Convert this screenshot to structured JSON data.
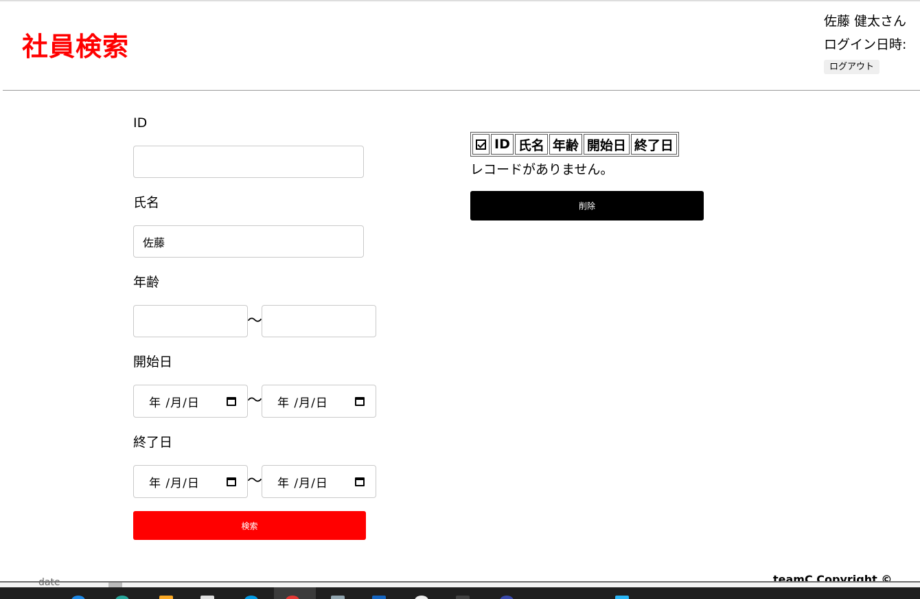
{
  "header": {
    "title": "社員検索",
    "user_name": "佐藤 健太さん",
    "login_label": "ログイン日時:",
    "logout_label": "ログアウト"
  },
  "form": {
    "id_label": "ID",
    "id_value": "",
    "name_label": "氏名",
    "name_value": "佐藤",
    "age_label": "年齢",
    "age_from": "",
    "age_to": "",
    "range_separator": "〜",
    "start_date_label": "開始日",
    "end_date_label": "終了日",
    "date_placeholder": "年 /月/日",
    "search_button": "検索"
  },
  "results": {
    "columns": [
      "☑",
      "ID",
      "氏名",
      "年齢",
      "開始日",
      "終了日"
    ],
    "empty_message": "レコードがありません。",
    "delete_button": "削除"
  },
  "footer": {
    "copyright": "teamC Copyright ©"
  },
  "background": {
    "tab_text": "date"
  },
  "colors": {
    "accent": "#ff0000",
    "delete": "#000000",
    "taskbar": "#1f1f1f"
  },
  "icons": {
    "calendar": "calendar-icon",
    "checkbox": "checkbox-icon"
  }
}
